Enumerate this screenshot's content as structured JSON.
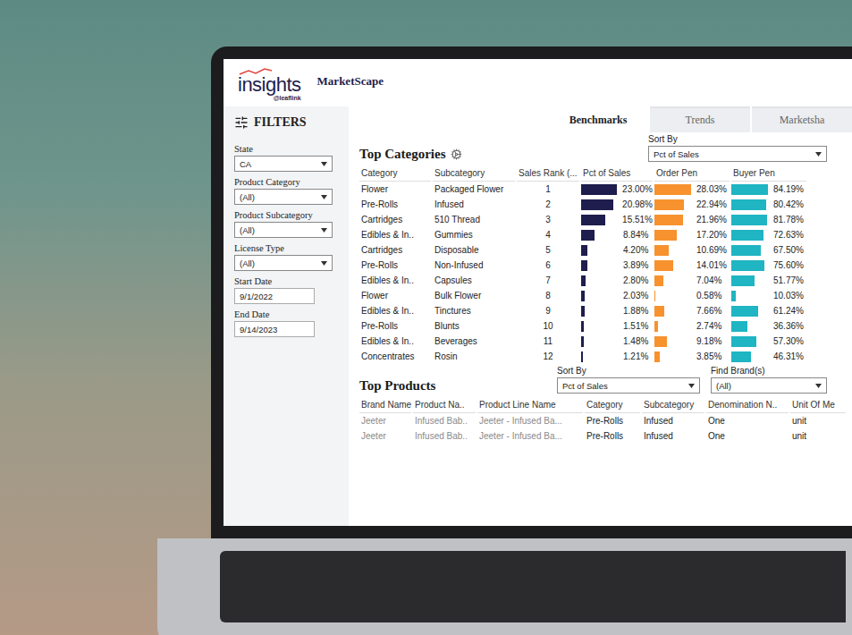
{
  "logo": {
    "text": "insights",
    "sub": "@leaflink"
  },
  "app_title": "MarketScape",
  "filters": {
    "title": "FILTERS",
    "fields": [
      {
        "label": "State",
        "value": "CA",
        "kind": "select"
      },
      {
        "label": "Product Category",
        "value": "(All)",
        "kind": "select"
      },
      {
        "label": "Product Subcategory",
        "value": "(All)",
        "kind": "select"
      },
      {
        "label": "License Type",
        "value": "(All)",
        "kind": "select"
      },
      {
        "label": "Start Date",
        "value": "9/1/2022",
        "kind": "date"
      },
      {
        "label": "End Date",
        "value": "9/14/2023",
        "kind": "date"
      }
    ]
  },
  "tabs": [
    {
      "label": "Benchmarks",
      "selected": true
    },
    {
      "label": "Trends",
      "selected": false
    },
    {
      "label": "Marketsha",
      "selected": false
    }
  ],
  "top_categories": {
    "title": "Top Categories",
    "sort_by": {
      "label": "Sort By",
      "value": "Pct of Sales"
    },
    "columns": [
      {
        "label": "Category",
        "kind": "text"
      },
      {
        "label": "Subcategory",
        "kind": "text"
      },
      {
        "label": "Sales Rank (...",
        "kind": "text"
      },
      {
        "label": "Pct of Sales",
        "kind": "bar",
        "color": "#1f1d4d"
      },
      {
        "label": "Order Pen",
        "kind": "bar",
        "color": "#f7922e"
      },
      {
        "label": "Buyer Pen",
        "kind": "bar",
        "color": "#1fb5c2"
      }
    ],
    "rows": [
      {
        "texts": [
          "Flower",
          "Packaged Flower",
          "1"
        ],
        "bars": [
          {
            "text": "23.00%",
            "level": 0.92
          },
          {
            "text": "28.03%",
            "level": 0.93
          },
          {
            "text": "84.19%",
            "level": 0.94
          }
        ]
      },
      {
        "texts": [
          "Pre-Rolls",
          "Infused",
          "2"
        ],
        "bars": [
          {
            "text": "20.98%",
            "level": 0.84
          },
          {
            "text": "22.94%",
            "level": 0.76
          },
          {
            "text": "80.42%",
            "level": 0.89
          }
        ]
      },
      {
        "texts": [
          "Cartridges",
          "510 Thread",
          "3"
        ],
        "bars": [
          {
            "text": "15.51%",
            "level": 0.62
          },
          {
            "text": "21.96%",
            "level": 0.73
          },
          {
            "text": "81.78%",
            "level": 0.91
          }
        ]
      },
      {
        "texts": [
          "Edibles & In..",
          "Gummies",
          "4"
        ],
        "bars": [
          {
            "text": "8.84%",
            "level": 0.35
          },
          {
            "text": "17.20%",
            "level": 0.57
          },
          {
            "text": "72.63%",
            "level": 0.81
          }
        ]
      },
      {
        "texts": [
          "Cartridges",
          "Disposable",
          "5"
        ],
        "bars": [
          {
            "text": "4.20%",
            "level": 0.17
          },
          {
            "text": "10.69%",
            "level": 0.36
          },
          {
            "text": "67.50%",
            "level": 0.75
          }
        ]
      },
      {
        "texts": [
          "Pre-Rolls",
          "Non-Infused",
          "6"
        ],
        "bars": [
          {
            "text": "3.89%",
            "level": 0.16
          },
          {
            "text": "14.01%",
            "level": 0.47
          },
          {
            "text": "75.60%",
            "level": 0.84
          }
        ]
      },
      {
        "texts": [
          "Edibles & In..",
          "Capsules",
          "7"
        ],
        "bars": [
          {
            "text": "2.80%",
            "level": 0.11
          },
          {
            "text": "7.04%",
            "level": 0.23
          },
          {
            "text": "51.77%",
            "level": 0.58
          }
        ]
      },
      {
        "texts": [
          "Flower",
          "Bulk Flower",
          "8"
        ],
        "bars": [
          {
            "text": "2.03%",
            "level": 0.08
          },
          {
            "text": "0.58%",
            "level": 0.02
          },
          {
            "text": "10.03%",
            "level": 0.11
          }
        ]
      },
      {
        "texts": [
          "Edibles & In..",
          "Tinctures",
          "9"
        ],
        "bars": [
          {
            "text": "1.88%",
            "level": 0.08
          },
          {
            "text": "7.66%",
            "level": 0.26
          },
          {
            "text": "61.24%",
            "level": 0.68
          }
        ]
      },
      {
        "texts": [
          "Pre-Rolls",
          "Blunts",
          "10"
        ],
        "bars": [
          {
            "text": "1.51%",
            "level": 0.06
          },
          {
            "text": "2.74%",
            "level": 0.09
          },
          {
            "text": "36.36%",
            "level": 0.4
          }
        ]
      },
      {
        "texts": [
          "Edibles & In..",
          "Beverages",
          "11"
        ],
        "bars": [
          {
            "text": "1.48%",
            "level": 0.06
          },
          {
            "text": "9.18%",
            "level": 0.31
          },
          {
            "text": "57.30%",
            "level": 0.64
          }
        ]
      },
      {
        "texts": [
          "Concentrates",
          "Rosin",
          "12"
        ],
        "bars": [
          {
            "text": "1.21%",
            "level": 0.05
          },
          {
            "text": "3.85%",
            "level": 0.13
          },
          {
            "text": "46.31%",
            "level": 0.51
          }
        ]
      }
    ]
  },
  "top_products": {
    "title": "Top Products",
    "sort_by": {
      "label": "Sort By",
      "value": "Pct of Sales"
    },
    "find": {
      "label": "Find Brand(s)",
      "value": "(All)"
    },
    "columns": [
      "Brand Name",
      "Product Na..",
      "Product Line Name",
      "Category",
      "Subcategory",
      "Denomination N..",
      "Unit Of Me"
    ],
    "rows": [
      [
        "Jeeter",
        "Infused Bab..",
        "Jeeter - Infused Ba...",
        "Pre-Rolls",
        "Infused",
        "One",
        "unit"
      ],
      [
        "Jeeter",
        "Infused Bab..",
        "Jeeter - Infused Ba...",
        "Pre-Rolls",
        "Infused",
        "One",
        "unit"
      ]
    ]
  }
}
